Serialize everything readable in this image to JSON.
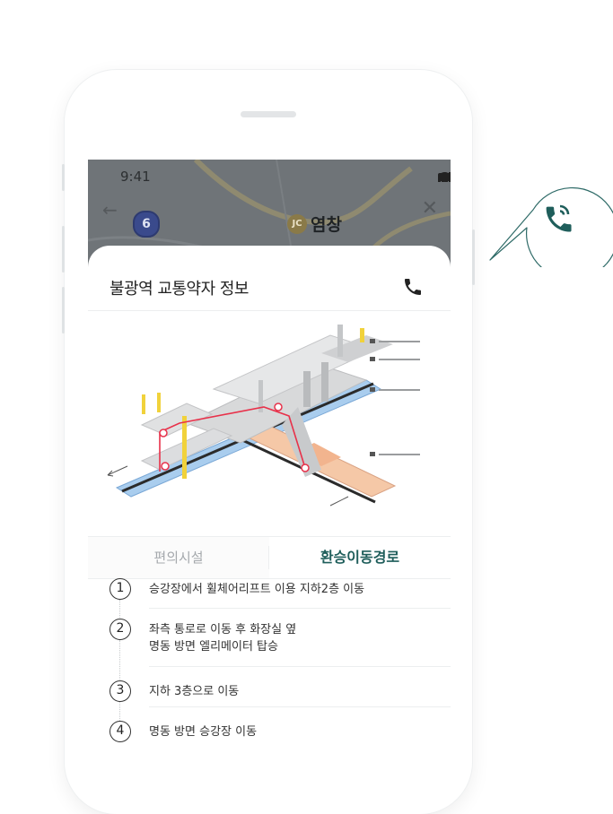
{
  "status_bar": {
    "time": "9:41"
  },
  "map": {
    "route_number": "6",
    "junction_badge": "JC",
    "station_name": "염창"
  },
  "sheet": {
    "title": "불광역 교통약자 정보"
  },
  "tabs": [
    {
      "label": "편의시설",
      "active": false
    },
    {
      "label": "환승이동경로",
      "active": true
    }
  ],
  "steps": [
    {
      "number": "1",
      "lines": [
        "승강장에서 휠체어리프트 이용 지하2층 이동"
      ]
    },
    {
      "number": "2",
      "lines": [
        "좌측 통로로 이동 후 화장실 옆",
        "명동 방면 엘리메이터 탑승"
      ]
    },
    {
      "number": "3",
      "lines": [
        "지하 3층으로 이동"
      ]
    },
    {
      "number": "4",
      "lines": [
        "명동 방면 승강장 이동"
      ]
    }
  ],
  "icons": {
    "header_call": "phone-icon",
    "floating_call": "phone-ringing-icon"
  },
  "colors": {
    "accent": "#1f5e5b",
    "call_bubble_border": "#2f6b68",
    "route_red": "#e8314a",
    "platform_blue": "#a9cdee",
    "platform_peach": "#f5c8a7"
  }
}
